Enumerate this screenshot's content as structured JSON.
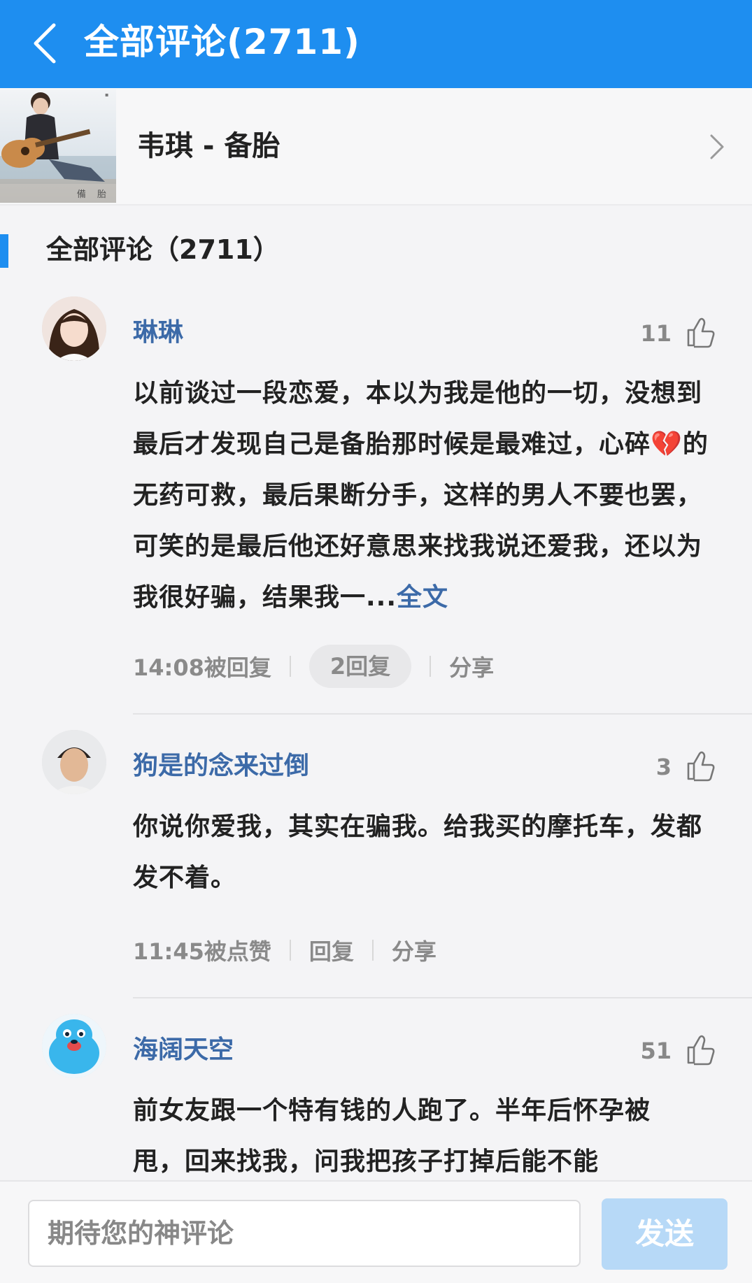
{
  "header": {
    "title": "全部评论(2711)"
  },
  "song": {
    "title": "韦琪 - 备胎",
    "album_caption": "備 胎"
  },
  "section": {
    "title": "全部评论（2711）"
  },
  "comments": [
    {
      "name": "琳琳",
      "likes": "11",
      "text": "以前谈过一段恋爱，本以为我是他的一切，没想到最后才发现自己是备胎那时候是最难过，心碎",
      "emoji": "💔",
      "text_after": "的无药可救，最后果断分手，这样的男人不要也罢，可笑的是最后他还好意思来找我说还爱我，还以为我很好骗，结果我一...",
      "more": "全文",
      "meta": "14:08被回复",
      "reply": "2回复",
      "share": "分享"
    },
    {
      "name": "狗是的念来过倒",
      "likes": "3",
      "text": "你说你爱我，其实在骗我。给我买的摩托车，发都发不着。",
      "meta": "11:45被点赞",
      "reply": "回复",
      "share": "分享"
    },
    {
      "name": "海阔天空",
      "likes": "51",
      "text": "前女友跟一个特有钱的人跑了。半年后怀孕被甩，回来找我，问我把孩子打掉后能不能"
    }
  ],
  "footer": {
    "input_placeholder": "期待您的神评论",
    "send": "发送"
  },
  "colors": {
    "accent": "#1e8ef0",
    "name": "#3c6aa8",
    "send_disabled": "#b7d9f7"
  }
}
